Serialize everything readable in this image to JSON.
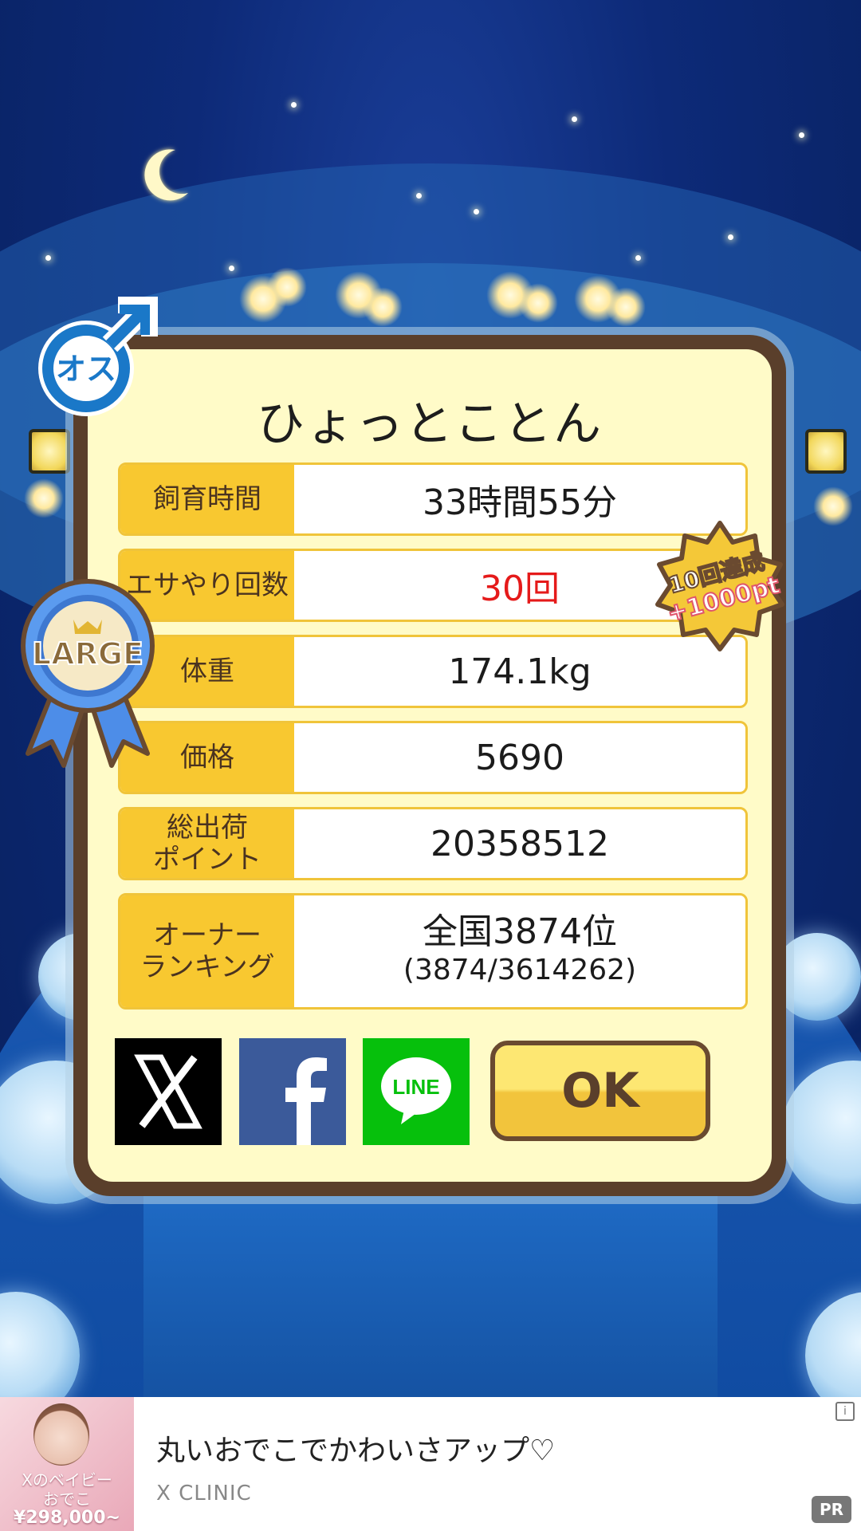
{
  "pet": {
    "name": "ひょっとことん",
    "gender_badge": "オス",
    "size_badge": "LARGE"
  },
  "stats": [
    {
      "label": "飼育時間",
      "value": "33時間55分"
    },
    {
      "label": "エサやり回数",
      "value": "30回"
    },
    {
      "label": "体重",
      "value": "174.1kg"
    },
    {
      "label": "価格",
      "value": "5690"
    },
    {
      "label": "総出荷\nポイント",
      "value": "20358512"
    }
  ],
  "ranking": {
    "label": "オーナー\nランキング",
    "rank": "全国3874位",
    "detail": "(3874/3614262)"
  },
  "bonus": {
    "line1": "10回達成",
    "line2": "+1000pt"
  },
  "buttons": {
    "ok": "OK",
    "line": "LINE"
  },
  "ad": {
    "title": "丸いおでこでかわいさアップ♡",
    "advertiser": "X CLINIC",
    "image_caption": "Xのベイビー\nおでこ",
    "image_price": "¥298,000~",
    "info": "i",
    "pr": "PR"
  },
  "colors": {
    "label_bg": "#f8c830",
    "card_border": "#5a3f2b",
    "card_bg": "#fffbc8",
    "highlight_red": "#e51a1a"
  }
}
